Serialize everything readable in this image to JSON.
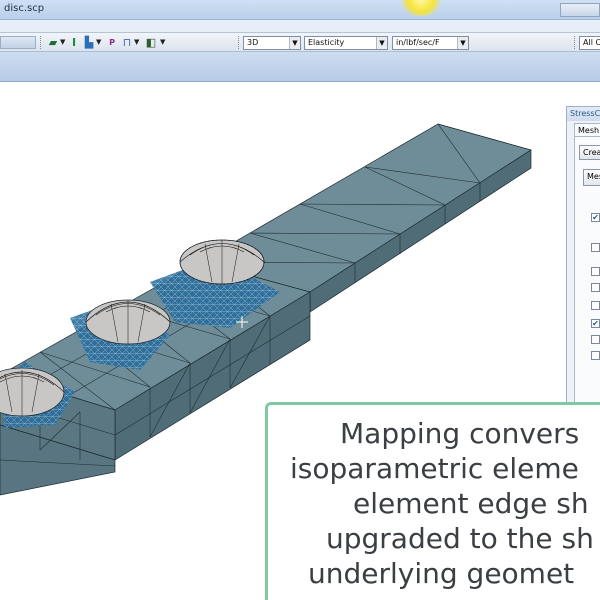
{
  "window": {
    "title": "disc.scp"
  },
  "toolbar": {
    "view_combo": "3D",
    "analysis_combo": "Elasticity",
    "units_combo": "in/lbf/sec/F",
    "filter_combo": "All Ob"
  },
  "panel": {
    "title": "StressCh",
    "tab": "Mesh",
    "create_button": "Creat",
    "mesh_button": "Mes",
    "checkboxes": [
      true,
      false,
      false,
      false,
      true,
      false,
      false
    ]
  },
  "caption": {
    "lines": [
      "Mapping convers",
      "isoparametric eleme",
      "element edge sh",
      "upgraded to the sh",
      "underlying geomet"
    ]
  },
  "icons": [
    "mesh-icon",
    "beam-icon",
    "chart-icon",
    "probe-icon",
    "load-icon",
    "camera-icon"
  ],
  "colors": {
    "mesh_top": "#6f8d98",
    "mesh_side": "#4f6c77",
    "hole_fill": "#c9c7c6",
    "refined_mesh": "#1f5f8e",
    "caption_border": "#7ec9a2",
    "caption_text": "#3b3f44"
  }
}
